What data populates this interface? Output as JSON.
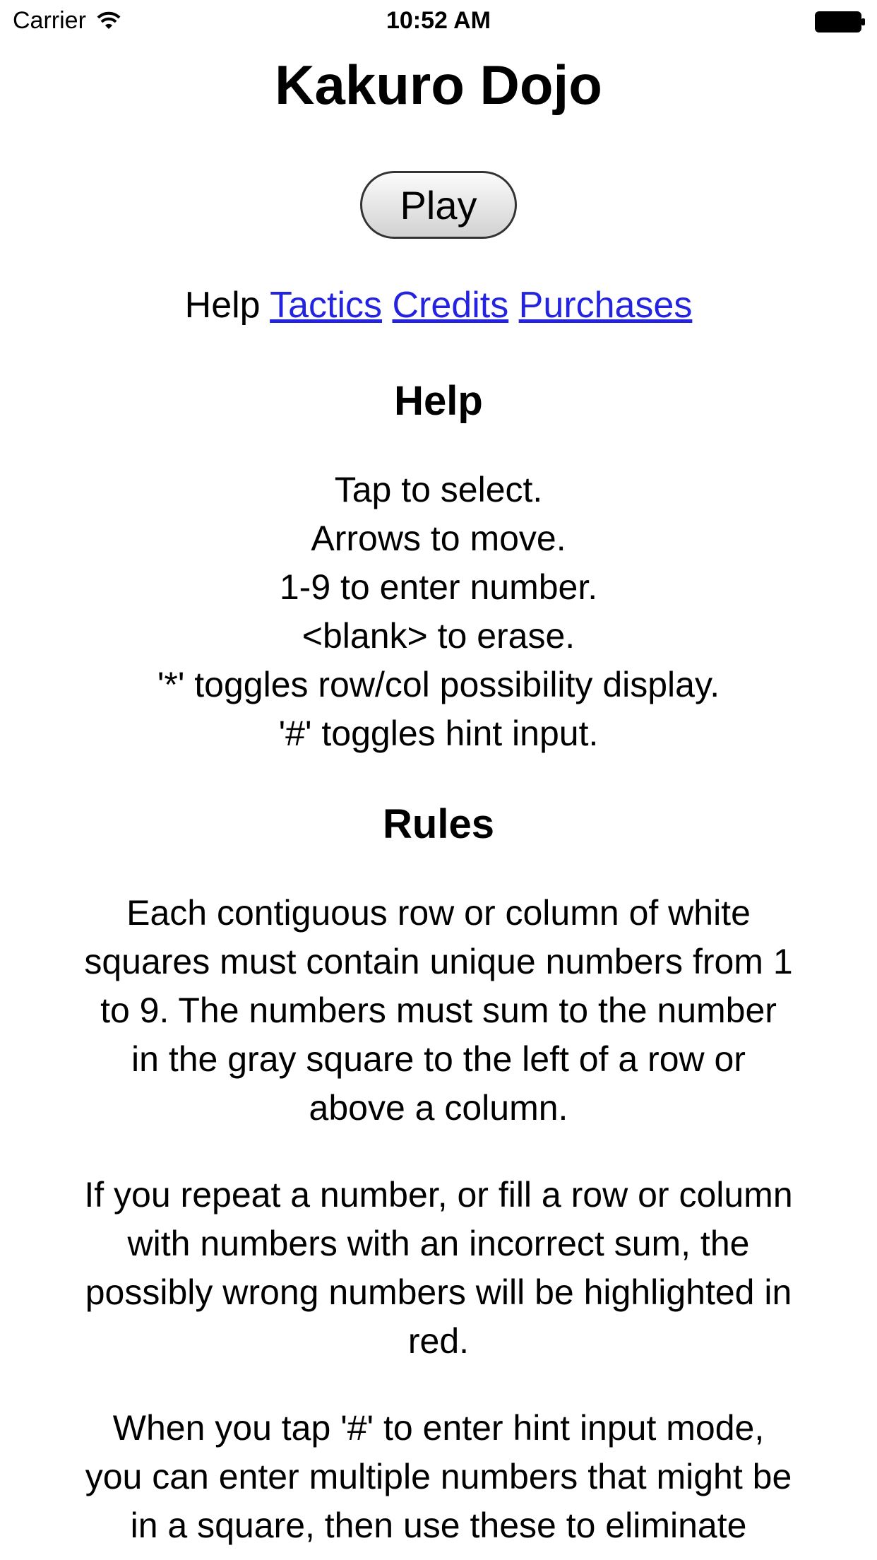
{
  "status_bar": {
    "carrier": "Carrier",
    "time": "10:52 AM",
    "icons": [
      "wifi-icon",
      "battery-icon"
    ]
  },
  "header": {
    "title": "Kakuro Dojo"
  },
  "play_button": {
    "label": "Play"
  },
  "nav": {
    "current": "Help",
    "links": [
      "Tactics",
      "Credits",
      "Purchases"
    ],
    "link_color": "#2424e0"
  },
  "help": {
    "heading": "Help",
    "lines": [
      "Tap to select.",
      "Arrows to move.",
      "1-9 to enter number.",
      "<blank> to erase.",
      "'*' toggles row/col possibility display.",
      "'#' toggles hint input."
    ]
  },
  "rules": {
    "heading": "Rules",
    "paragraphs": [
      "Each contiguous row or column of white squares must contain unique numbers from 1 to 9. The numbers must sum to the number in the gray square to the left of a row or above a column.",
      "If you repeat a number, or fill a row or column with numbers with an incorrect sum, the possibly wrong numbers will be highlighted in red.",
      "When you tap '#' to enter hint input mode, you can enter multiple numbers that might be in a square, then use these to eliminate"
    ]
  }
}
